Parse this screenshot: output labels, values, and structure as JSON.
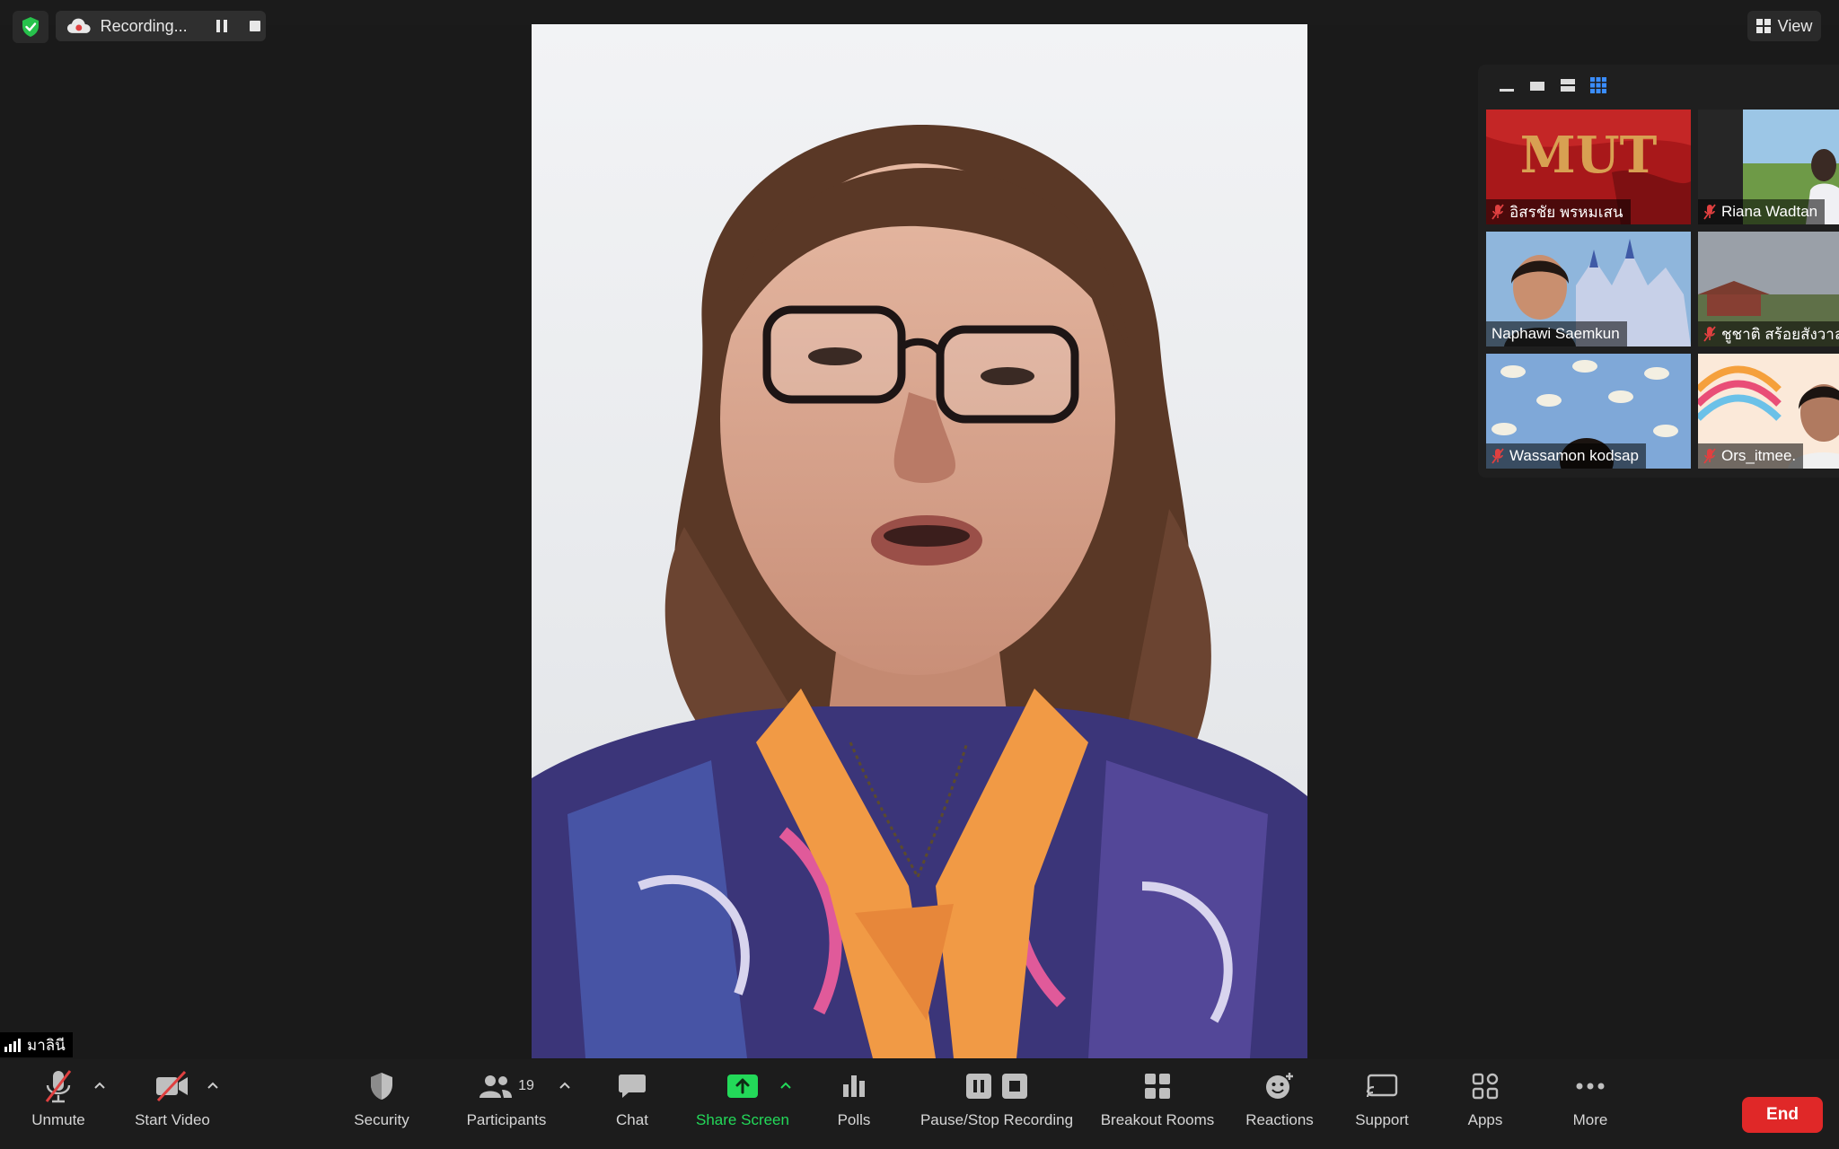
{
  "topbar": {
    "recording_label": "Recording...",
    "view_label": "View"
  },
  "gallery": {
    "tiles": [
      {
        "name": "อิสรชัย พรหมเสน",
        "muted": true,
        "logo_text": "MUT"
      },
      {
        "name": "Riana Wadtan",
        "muted": true
      },
      {
        "name": "Naphawi Saemkun",
        "muted": false
      },
      {
        "name": "ชูชาติ สร้อยสังวาล",
        "muted": true
      },
      {
        "name": "Wassamon kodsap",
        "muted": true
      },
      {
        "name": "Ors_itmee.",
        "muted": true
      }
    ]
  },
  "active_speaker": {
    "name": "มาลินี"
  },
  "toolbar": {
    "unmute": "Unmute",
    "start_video": "Start Video",
    "security": "Security",
    "participants": "Participants",
    "participants_count": "19",
    "chat": "Chat",
    "share_screen": "Share Screen",
    "polls": "Polls",
    "pause_stop_recording": "Pause/Stop Recording",
    "breakout_rooms": "Breakout Rooms",
    "reactions": "Reactions",
    "support": "Support",
    "apps": "Apps",
    "more": "More",
    "end": "End"
  },
  "colors": {
    "share_green": "#23d959",
    "end_red": "#e02828",
    "mute_red": "#e04040",
    "shield_green": "#27c24c"
  }
}
